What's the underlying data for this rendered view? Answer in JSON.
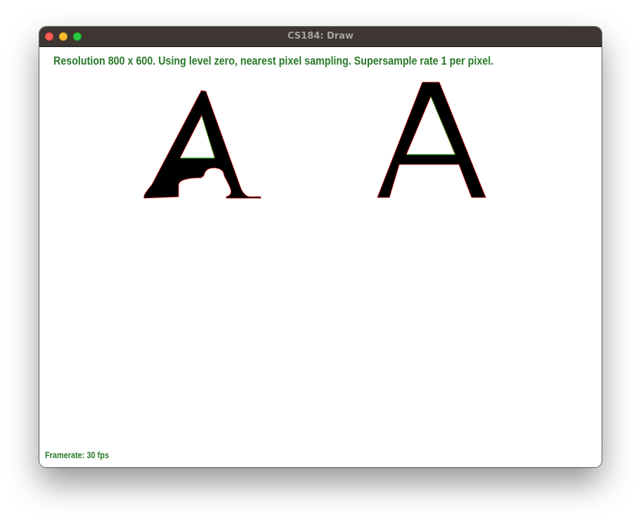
{
  "window": {
    "title": "CS184: Draw"
  },
  "canvas": {
    "status": "Resolution 800 x 600. Using level zero, nearest pixel sampling. Supersample rate 1 per pixel.",
    "framerate": "Framerate: 30 fps",
    "glyphs": [
      "serif-letter-a",
      "sans-letter-a"
    ]
  },
  "colors": {
    "titlebar": "#3d3632",
    "title_text": "#a7a29f",
    "status_text": "#2a7a2a",
    "glyph_fill": "#000000",
    "outer_edge": "#cc0000",
    "inner_edge": "#00aa00"
  }
}
